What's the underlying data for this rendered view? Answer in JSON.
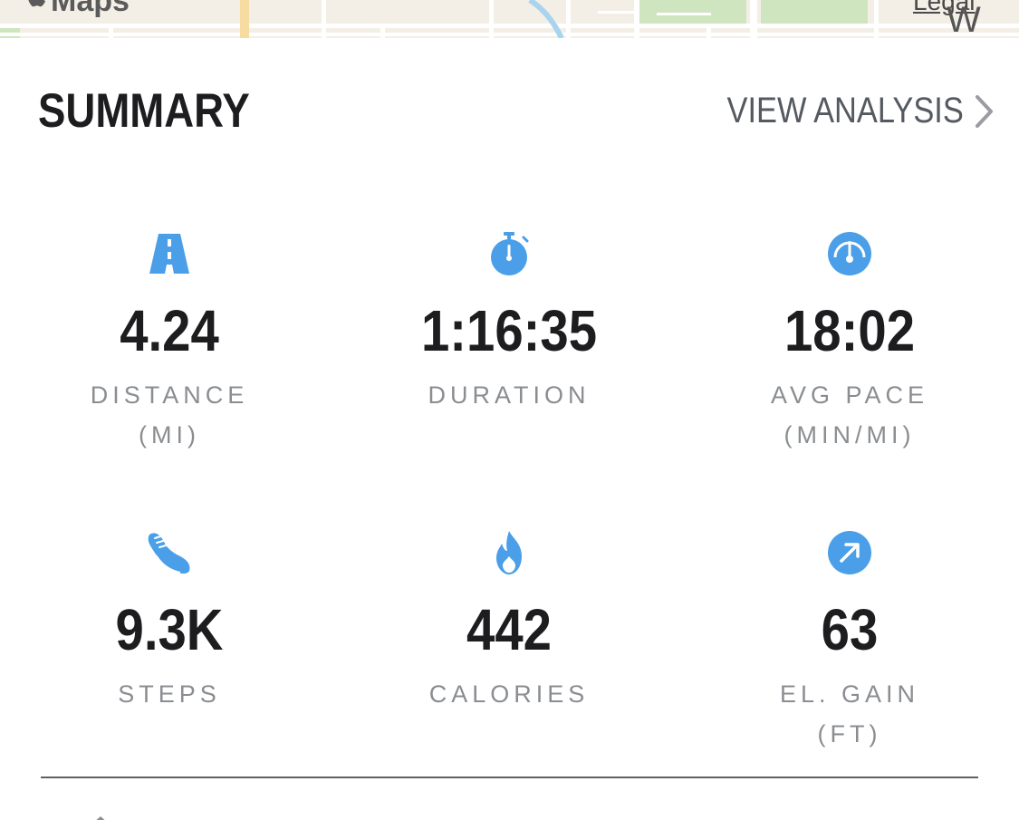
{
  "map": {
    "attribution": "Maps",
    "legal": "Legal",
    "street_label": "W P"
  },
  "summary": {
    "title": "SUMMARY",
    "view_analysis_label": "VIEW ANALYSIS"
  },
  "stats": [
    {
      "icon": "road-icon",
      "value": "4.24",
      "label": "DISTANCE",
      "unit": "(MI)"
    },
    {
      "icon": "stopwatch-icon",
      "value": "1:16:35",
      "label": "DURATION",
      "unit": ""
    },
    {
      "icon": "speedometer-icon",
      "value": "18:02",
      "label": "AVG PACE",
      "unit": "(MIN/MI)"
    },
    {
      "icon": "shoe-icon",
      "value": "9.3K",
      "label": "STEPS",
      "unit": ""
    },
    {
      "icon": "flame-icon",
      "value": "442",
      "label": "CALORIES",
      "unit": ""
    },
    {
      "icon": "elevation-arrow-icon",
      "value": "63",
      "label": "EL. GAIN",
      "unit": "(FT)"
    }
  ],
  "colors": {
    "accent_blue": "#4a9fe8",
    "text_primary": "#1d1d1f",
    "text_secondary": "#8a8d91",
    "link_gray": "#555a61"
  }
}
